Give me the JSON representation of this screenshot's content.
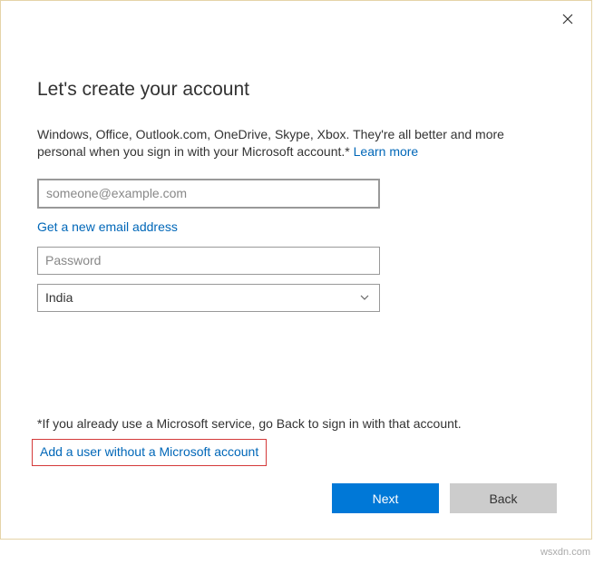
{
  "title": "Let's create your account",
  "description_prefix": "Windows, Office, Outlook.com, OneDrive, Skype, Xbox. They're all better and more personal when you sign in with your Microsoft account.* ",
  "learn_more": "Learn more",
  "email_placeholder": "someone@example.com",
  "new_email_link": "Get a new email address",
  "password_placeholder": "Password",
  "country_value": "India",
  "footnote": "*If you already use a Microsoft service, go Back to sign in with that account.",
  "add_user_link": "Add a user without a Microsoft account",
  "buttons": {
    "next": "Next",
    "back": "Back"
  },
  "watermark": "wsxdn.com"
}
